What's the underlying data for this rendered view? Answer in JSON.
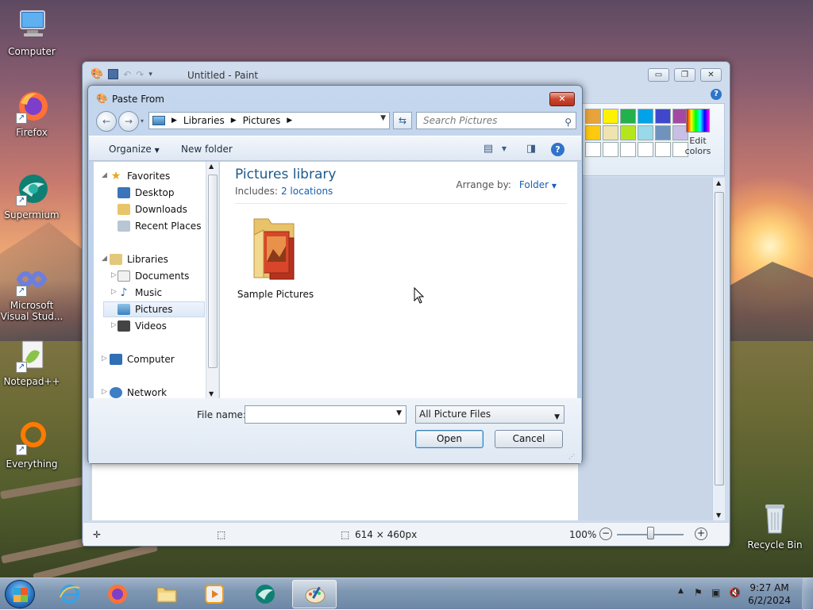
{
  "desktop": {
    "icons": [
      {
        "label": "Computer",
        "icon": "computer-icon"
      },
      {
        "label": "Firefox",
        "icon": "firefox-icon"
      },
      {
        "label": "Supermium",
        "icon": "supermium-icon"
      },
      {
        "label": "Microsoft Visual Stud...",
        "icon": "visual-studio-icon"
      },
      {
        "label": "Notepad++",
        "icon": "notepadpp-icon"
      },
      {
        "label": "Everything",
        "icon": "everything-icon"
      },
      {
        "label": "Recycle Bin",
        "icon": "recycle-bin-icon"
      }
    ]
  },
  "paint": {
    "title": "Untitled - Paint",
    "edit_colors": "Edit colors",
    "palette": [
      "#e8a33a",
      "#fff200",
      "#22b14c",
      "#00a2e8",
      "#3f48cc",
      "#a349a4",
      "#ffc90e",
      "#efe4b0",
      "#b5e61d",
      "#99d9ea",
      "#7092be",
      "#c8bfe7",
      "#ffffff",
      "#ffffff",
      "#ffffff",
      "#ffffff",
      "#ffffff",
      "#ffffff"
    ],
    "status": {
      "size": "614 × 460px",
      "zoom": "100%",
      "zoom_level": 0.5
    }
  },
  "dialog": {
    "title": "Paste From",
    "address": {
      "crumbs": [
        "Libraries",
        "Pictures"
      ]
    },
    "search_placeholder": "Search Pictures",
    "toolbar": {
      "organize": "Organize",
      "new_folder": "New folder"
    },
    "nav": {
      "favorites": "Favorites",
      "desktop": "Desktop",
      "downloads": "Downloads",
      "recent_places": "Recent Places",
      "libraries": "Libraries",
      "documents": "Documents",
      "music": "Music",
      "pictures": "Pictures",
      "videos": "Videos",
      "computer": "Computer",
      "network": "Network"
    },
    "content": {
      "title": "Pictures library",
      "includes_label": "Includes:",
      "includes_link": "2 locations",
      "arrange_label": "Arrange by:",
      "arrange_value": "Folder",
      "items": [
        {
          "label": "Sample Pictures"
        }
      ]
    },
    "filename_label": "File name:",
    "filename_value": "",
    "filter": "All Picture Files",
    "open": "Open",
    "cancel": "Cancel"
  },
  "taskbar": {
    "time": "9:27 AM",
    "date": "6/2/2024",
    "pinned": [
      "start-orb",
      "internet-explorer-icon",
      "firefox-icon",
      "file-explorer-icon",
      "media-player-icon",
      "supermium-icon",
      "paint-icon"
    ]
  }
}
